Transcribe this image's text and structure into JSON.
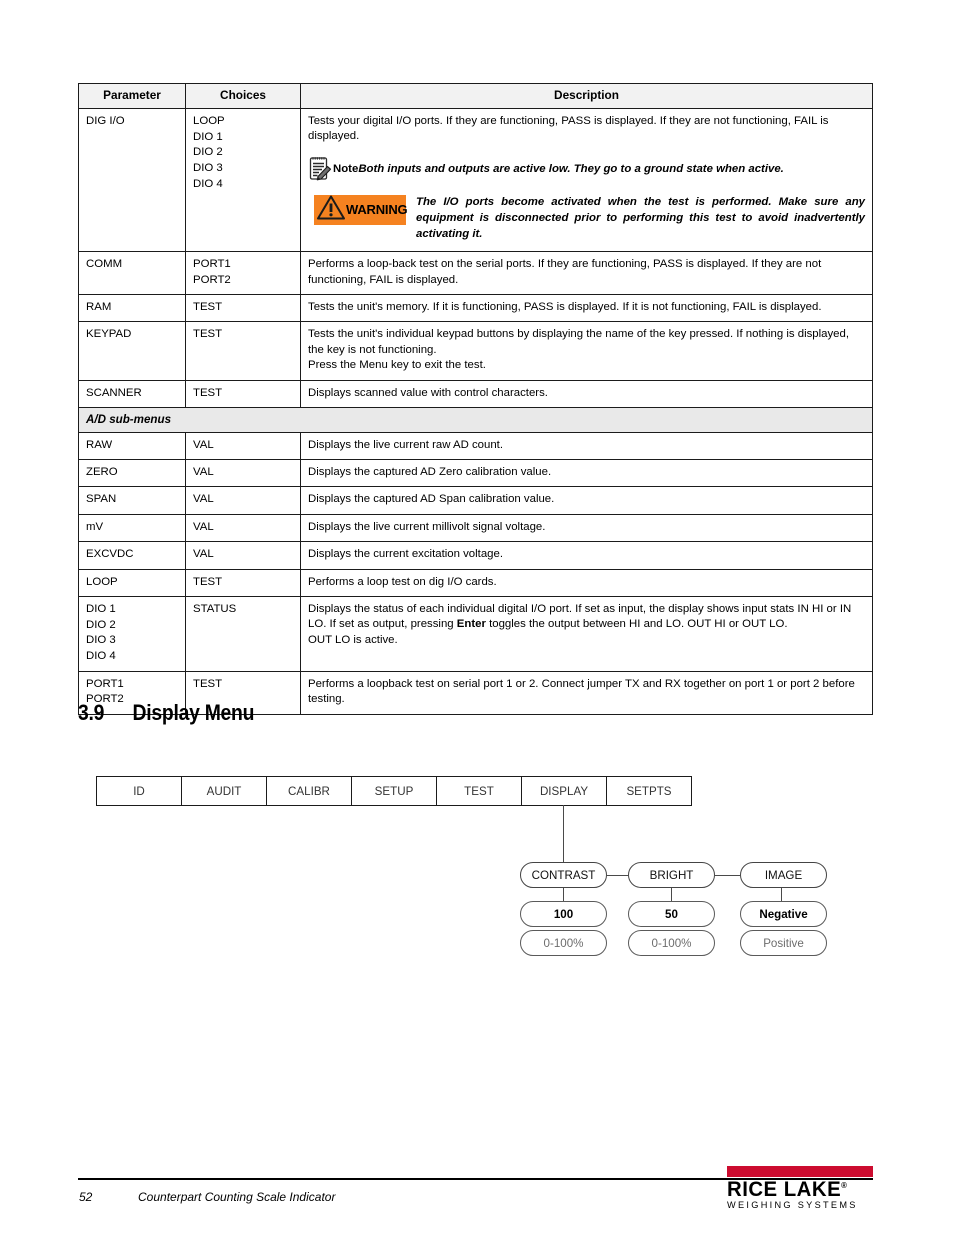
{
  "table": {
    "headers": [
      "Parameter",
      "Choices",
      "Description"
    ],
    "rows": [
      {
        "parameter": "DIG I/O",
        "choices": "LOOP\nDIO 1\nDIO 2\nDIO 3\nDIO 4",
        "description": "Tests your digital I/O ports. If they are functioning, PASS is displayed. If they are not functioning, FAIL is displayed.",
        "note": {
          "icon": "note-pad-pencil-icon",
          "label": "Note",
          "text": "Both inputs and outputs are active low. They go to a ground state when active."
        },
        "warning": {
          "icon": "warning-triangle-icon",
          "label": "WARNING",
          "color": "#f58220",
          "text": "The I/O ports become activated when the test is performed. Make sure any equipment is disconnected prior to performing this test to avoid inadvertently activating it."
        }
      },
      {
        "parameter": "COMM",
        "choices": "PORT1\nPORT2",
        "description": "Performs a loop-back test on the serial ports. If they are functioning, PASS is displayed. If they are not functioning, FAIL is displayed."
      },
      {
        "parameter": "RAM",
        "choices": "TEST",
        "description": "Tests the unit's memory. If it is functioning, PASS is displayed. If it is not functioning, FAIL is displayed."
      },
      {
        "parameter": "KEYPAD",
        "choices": "TEST",
        "description": "Tests the unit's individual keypad buttons by displaying the name of the key pressed. If nothing is displayed, the key is not functioning.",
        "description2": "Press the Menu key to exit the test."
      },
      {
        "parameter": "SCANNER",
        "choices": "TEST",
        "description": "Displays scanned value with control characters."
      }
    ],
    "subheading": "A/D sub-menus",
    "rows2": [
      {
        "parameter": "RAW",
        "choices": "VAL",
        "description": "Displays the live current raw AD count."
      },
      {
        "parameter": "ZERO",
        "choices": "VAL",
        "description": "Displays the captured AD Zero calibration value."
      },
      {
        "parameter": "SPAN",
        "choices": "VAL",
        "description": "Displays the captured AD Span calibration value."
      },
      {
        "parameter": "mV",
        "choices": "VAL",
        "description": "Displays the live current millivolt signal voltage."
      },
      {
        "parameter": "EXCVDC",
        "choices": "VAL",
        "description": "Displays the current excitation voltage."
      },
      {
        "parameter": "LOOP",
        "choices": "TEST",
        "description": "Performs a loop test on dig I/O cards."
      },
      {
        "parameter": "DIO 1\nDIO 2\nDIO 3\nDIO 4",
        "choices": "STATUS",
        "description_a": "Displays the status of each individual digital I/O port. If set as input, the display shows input stats IN HI or IN LO. If set as output, pressing ",
        "description_bold": "Enter",
        "description_b": " toggles the output between HI and LO. OUT HI or OUT LO.",
        "description2": "OUT LO is active."
      },
      {
        "parameter": "PORT1\nPORT2",
        "choices": "TEST",
        "description": "Performs a loopback test on serial port 1 or 2. Connect jumper TX and RX together on port 1 or port 2 before testing."
      }
    ]
  },
  "section": {
    "number": "3.9",
    "title": "Display Menu"
  },
  "menu": {
    "bar": [
      "ID",
      "AUDIT",
      "CALIBR",
      "SETUP",
      "TEST",
      "DISPLAY",
      "SETPTS"
    ],
    "selected": "DISPLAY",
    "columns": [
      {
        "name": "CONTRAST",
        "value": "100",
        "range": "0-100%"
      },
      {
        "name": "BRIGHT",
        "value": "50",
        "range": "0-100%"
      },
      {
        "name": "IMAGE",
        "value": "Negative",
        "range": "Positive"
      }
    ]
  },
  "footer": {
    "page": "52",
    "title": "Counterpart Counting Scale Indicator",
    "logo": {
      "name": "RICE LAKE",
      "registered": "®",
      "subtitle": "WEIGHING SYSTEMS",
      "bar_color": "#cc0c2f"
    }
  }
}
